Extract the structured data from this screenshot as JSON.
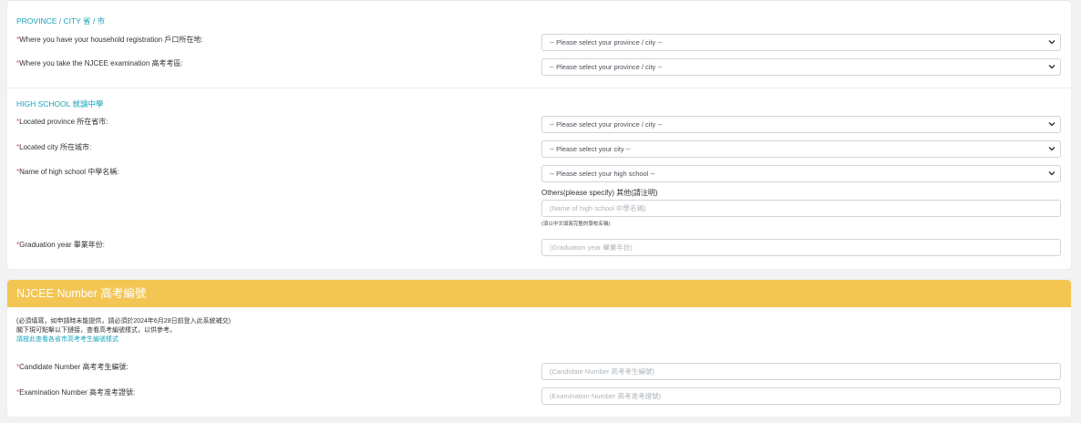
{
  "province_section": {
    "title": "PROVINCE / CITY 省 / 市",
    "household_label": "Where you have your household registration 戶口所在地:",
    "household_select": "-- Please select your province / city --",
    "exam_label": "Where you take the NJCEE examination 高考考區:",
    "exam_select": "-- Please select your province / city --"
  },
  "high_school_section": {
    "title": "HIGH SCHOOL 就讀中學",
    "province_label": "Located province 所在省市:",
    "province_select": "-- Please select your province / city --",
    "city_label": "Located city 所在城市:",
    "city_select": "-- Please select your city --",
    "school_label": "Name of high school 中學名稱:",
    "school_select": "-- Please select your high school --",
    "others_label": "Others(please specify) 其他(請注明)",
    "others_placeholder": "(Name of high school 中學名稱)",
    "others_note": "(須以中文填寫完整的學校名稱)",
    "grad_label": "Graduation year 畢業年份:",
    "grad_placeholder": "(Graduation year 畢業年份)"
  },
  "njcee_section": {
    "title": "NJCEE Number 高考編號",
    "instruction_1": "(必須填寫，如申請時未能提供，請必須於2024年6月28日前登入此系統補交)",
    "instruction_2": "閣下現可點擊以下鏈接，查看高考編號樣式，以供參考。",
    "link_text": "請按此查看各省市高考考生編號樣式",
    "candidate_label": "Candidate Number 高考考生編號:",
    "candidate_placeholder": "(Candidate Number 高考考生編號)",
    "exam_no_label": "Examination Number 高考准考證號:",
    "exam_no_placeholder": "(Examination Number 高考准考證號)"
  },
  "required_marker": "*",
  "colors": {
    "accent": "#17a2b8",
    "required": "#e0534c",
    "banner": "#f3c553"
  },
  "icons": {
    "select_arrow": "chevron-down-icon"
  }
}
